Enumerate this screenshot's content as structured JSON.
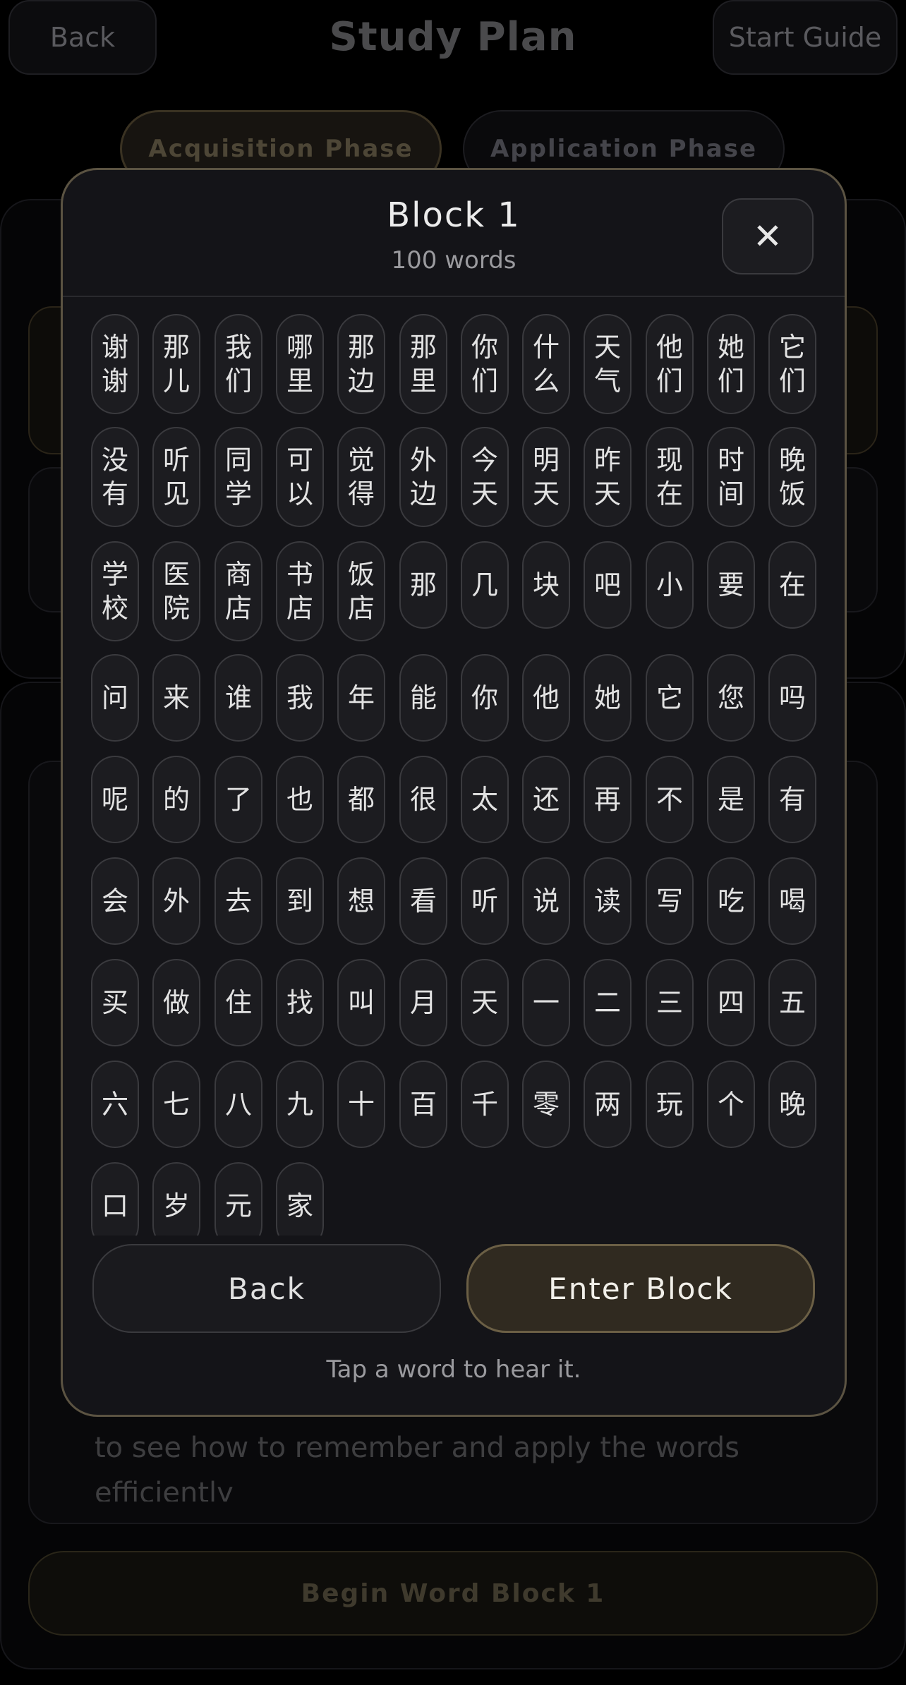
{
  "header": {
    "back_label": "Back",
    "title": "Study Plan",
    "guide_label": "Start Guide"
  },
  "phases": {
    "acquisition": "Acquisition Phase",
    "application": "Application Phase"
  },
  "background": {
    "card_text": "to see how to remember and apply the words efficiently",
    "begin_label": "Begin Word Block 1"
  },
  "modal": {
    "title": "Block 1",
    "subtitle": "100 words",
    "close_glyph": "✕",
    "back_label": "Back",
    "enter_label": "Enter Block",
    "hint": "Tap a word to hear it."
  },
  "words": [
    [
      "谢谢",
      "那儿",
      "我们",
      "哪里",
      "那边",
      "那里",
      "你们",
      "什么",
      "天气",
      "他们",
      "她们",
      "它们"
    ],
    [
      "没有",
      "听见",
      "同学",
      "可以",
      "觉得",
      "外边",
      "今天",
      "明天",
      "昨天",
      "现在",
      "时间",
      "晚饭"
    ],
    [
      "学校",
      "医院",
      "商店",
      "书店",
      "饭店",
      "那",
      "几",
      "块",
      "吧",
      "小",
      "要",
      "在"
    ],
    [
      "问",
      "来",
      "谁",
      "我",
      "年",
      "能",
      "你",
      "他",
      "她",
      "它",
      "您",
      "吗"
    ],
    [
      "呢",
      "的",
      "了",
      "也",
      "都",
      "很",
      "太",
      "还",
      "再",
      "不",
      "是",
      "有"
    ],
    [
      "会",
      "外",
      "去",
      "到",
      "想",
      "看",
      "听",
      "说",
      "读",
      "写",
      "吃",
      "喝"
    ],
    [
      "买",
      "做",
      "住",
      "找",
      "叫",
      "月",
      "天",
      "一",
      "二",
      "三",
      "四",
      "五"
    ],
    [
      "六",
      "七",
      "八",
      "九",
      "十",
      "百",
      "千",
      "零",
      "两",
      "玩",
      "个",
      "晚"
    ],
    [
      "口",
      "岁",
      "元",
      "家"
    ]
  ]
}
